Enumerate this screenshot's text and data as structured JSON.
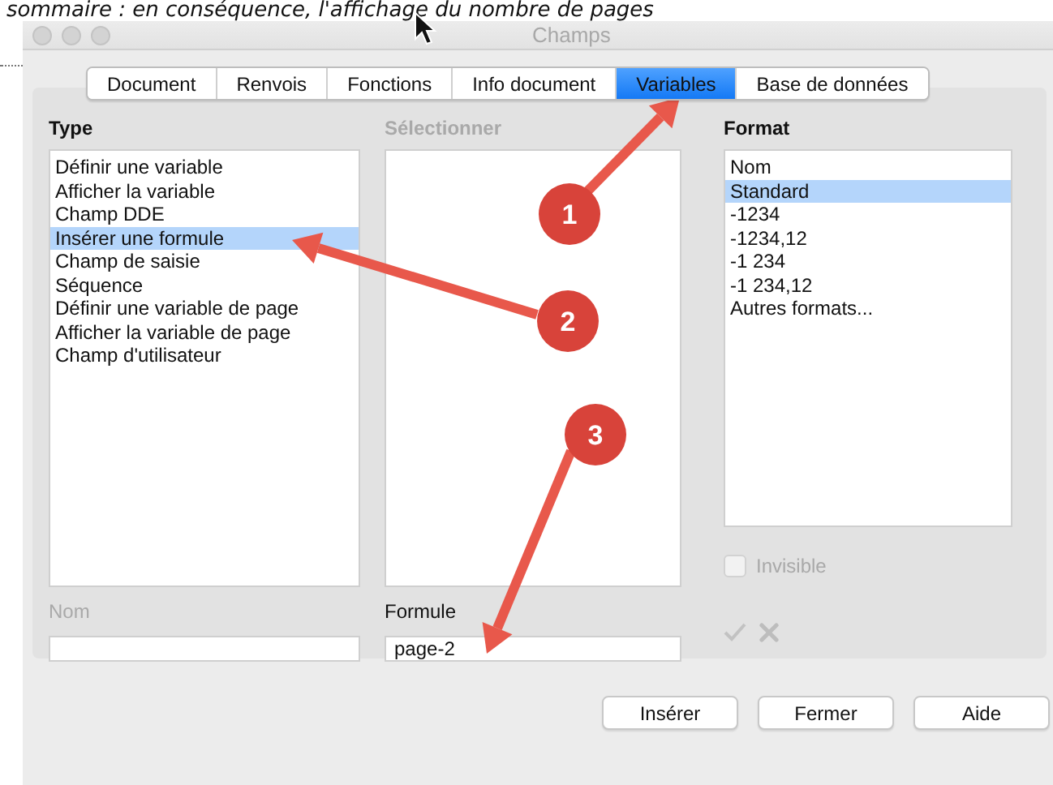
{
  "caption": "sommaire : en conséquence, l'affichage du nombre de pages",
  "window": {
    "title": "Champs"
  },
  "tabs": [
    {
      "label": "Document",
      "selected": false
    },
    {
      "label": "Renvois",
      "selected": false
    },
    {
      "label": "Fonctions",
      "selected": false
    },
    {
      "label": "Info document",
      "selected": false
    },
    {
      "label": "Variables",
      "selected": true
    },
    {
      "label": "Base de données",
      "selected": false
    }
  ],
  "type_list": {
    "heading": "Type",
    "items": [
      {
        "label": "Définir une variable",
        "selected": false
      },
      {
        "label": "Afficher la variable",
        "selected": false
      },
      {
        "label": "Champ DDE",
        "selected": false
      },
      {
        "label": "Insérer une formule",
        "selected": true
      },
      {
        "label": "Champ de saisie",
        "selected": false
      },
      {
        "label": "Séquence",
        "selected": false
      },
      {
        "label": "Définir une variable de page",
        "selected": false
      },
      {
        "label": "Afficher la variable de page",
        "selected": false
      },
      {
        "label": "Champ d'utilisateur",
        "selected": false
      }
    ]
  },
  "select_list": {
    "heading": "Sélectionner",
    "disabled": true
  },
  "format_list": {
    "heading": "Format",
    "items": [
      {
        "label": "Nom",
        "selected": false
      },
      {
        "label": "Standard",
        "selected": true
      },
      {
        "label": "-1234",
        "selected": false
      },
      {
        "label": "-1234,12",
        "selected": false
      },
      {
        "label": "-1 234",
        "selected": false
      },
      {
        "label": "-1 234,12",
        "selected": false
      },
      {
        "label": "Autres formats...",
        "selected": false
      }
    ]
  },
  "invisible": {
    "label": "Invisible",
    "checked": false,
    "disabled": true
  },
  "name_field": {
    "label": "Nom",
    "disabled": true
  },
  "formula_field": {
    "label": "Formule",
    "value": "page-2"
  },
  "buttons": [
    "Insérer",
    "Fermer",
    "Aide"
  ],
  "annotations": [
    {
      "number": "1"
    },
    {
      "number": "2"
    },
    {
      "number": "3"
    }
  ]
}
